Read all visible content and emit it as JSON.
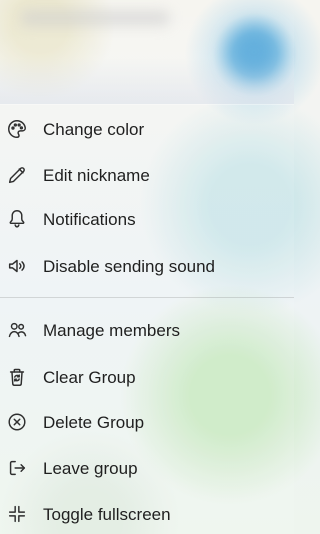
{
  "menu": {
    "items": [
      {
        "label": "Change color",
        "icon": "palette-icon"
      },
      {
        "label": "Edit nickname",
        "icon": "pencil-icon"
      },
      {
        "label": "Notifications",
        "icon": "bell-icon"
      },
      {
        "label": "Disable sending sound",
        "icon": "speaker-sound-icon"
      },
      {
        "label": "Manage members",
        "icon": "people-icon"
      },
      {
        "label": "Clear Group",
        "icon": "trash-refresh-icon"
      },
      {
        "label": "Delete Group",
        "icon": "circle-x-icon"
      },
      {
        "label": "Leave group",
        "icon": "exit-icon"
      },
      {
        "label": "Toggle fullscreen",
        "icon": "collapse-arrows-icon"
      }
    ]
  }
}
